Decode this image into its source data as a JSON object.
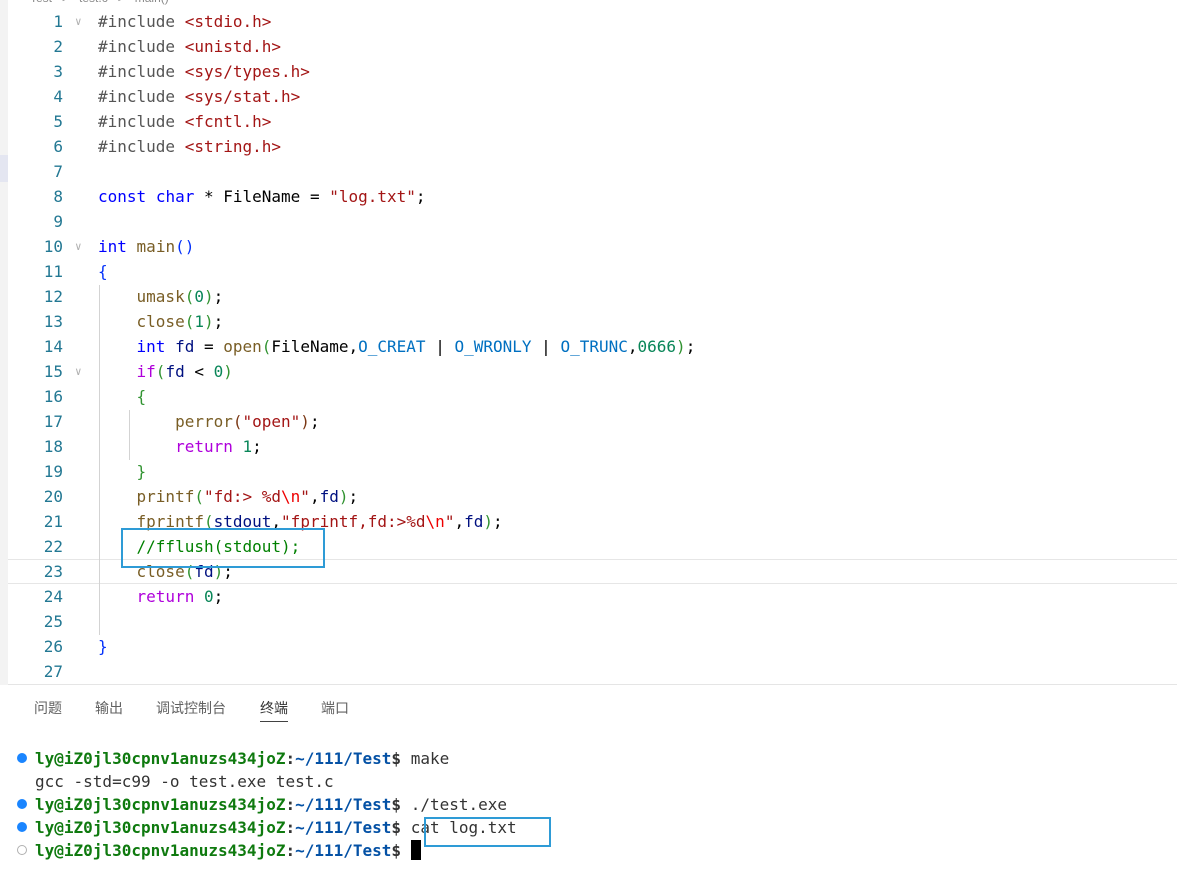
{
  "breadcrumb": [
    "Test",
    ">",
    "test.c",
    ">",
    "main()"
  ],
  "code_lines": [
    {
      "n": "1",
      "tokens": [
        [
          "pre",
          "#include "
        ],
        [
          "str",
          "<stdio.h>"
        ]
      ]
    },
    {
      "n": "2",
      "tokens": [
        [
          "pre",
          "#include "
        ],
        [
          "str",
          "<unistd.h>"
        ]
      ]
    },
    {
      "n": "3",
      "tokens": [
        [
          "pre",
          "#include "
        ],
        [
          "str",
          "<sys/types.h>"
        ]
      ]
    },
    {
      "n": "4",
      "tokens": [
        [
          "pre",
          "#include "
        ],
        [
          "str",
          "<sys/stat.h>"
        ]
      ]
    },
    {
      "n": "5",
      "tokens": [
        [
          "pre",
          "#include "
        ],
        [
          "str",
          "<fcntl.h>"
        ]
      ]
    },
    {
      "n": "6",
      "tokens": [
        [
          "pre",
          "#include "
        ],
        [
          "str",
          "<string.h>"
        ]
      ]
    },
    {
      "n": "7",
      "tokens": []
    },
    {
      "n": "8",
      "tokens": [
        [
          "kw",
          "const"
        ],
        [
          "",
          " "
        ],
        [
          "kw",
          "char"
        ],
        [
          "",
          " * "
        ],
        [
          "",
          "FileName"
        ],
        [
          "",
          " = "
        ],
        [
          "str",
          "\"log.txt\""
        ],
        [
          "",
          ";"
        ]
      ]
    },
    {
      "n": "9",
      "tokens": []
    },
    {
      "n": "10",
      "tokens": [
        [
          "kw",
          "int"
        ],
        [
          "",
          " "
        ],
        [
          "fn",
          "main"
        ],
        [
          "b1",
          "()"
        ]
      ]
    },
    {
      "n": "11",
      "tokens": [
        [
          "b1",
          "{"
        ]
      ]
    },
    {
      "n": "12",
      "tokens": [
        [
          "",
          "    "
        ],
        [
          "fn",
          "umask"
        ],
        [
          "b2",
          "("
        ],
        [
          "num",
          "0"
        ],
        [
          "b2",
          ")"
        ],
        [
          "",
          ";"
        ]
      ]
    },
    {
      "n": "13",
      "tokens": [
        [
          "",
          "    "
        ],
        [
          "fn",
          "close"
        ],
        [
          "b2",
          "("
        ],
        [
          "num",
          "1"
        ],
        [
          "b2",
          ")"
        ],
        [
          "",
          ";"
        ]
      ]
    },
    {
      "n": "14",
      "tokens": [
        [
          "",
          "    "
        ],
        [
          "kw",
          "int"
        ],
        [
          "",
          " "
        ],
        [
          "var",
          "fd"
        ],
        [
          "",
          " = "
        ],
        [
          "fn",
          "open"
        ],
        [
          "b2",
          "("
        ],
        [
          "",
          "FileName,"
        ],
        [
          "mac",
          "O_CREAT"
        ],
        [
          "",
          " | "
        ],
        [
          "mac",
          "O_WRONLY"
        ],
        [
          "",
          " | "
        ],
        [
          "mac",
          "O_TRUNC"
        ],
        [
          "",
          ","
        ],
        [
          "num",
          "0666"
        ],
        [
          "b2",
          ")"
        ],
        [
          "",
          ";"
        ]
      ]
    },
    {
      "n": "15",
      "tokens": [
        [
          "",
          "    "
        ],
        [
          "ctl",
          "if"
        ],
        [
          "b2",
          "("
        ],
        [
          "var",
          "fd"
        ],
        [
          "",
          " < "
        ],
        [
          "num",
          "0"
        ],
        [
          "b2",
          ")"
        ]
      ]
    },
    {
      "n": "16",
      "tokens": [
        [
          "",
          "    "
        ],
        [
          "b2",
          "{"
        ]
      ]
    },
    {
      "n": "17",
      "tokens": [
        [
          "",
          "        "
        ],
        [
          "fn",
          "perror"
        ],
        [
          "b3",
          "("
        ],
        [
          "str",
          "\"open\""
        ],
        [
          "b3",
          ")"
        ],
        [
          "",
          ";"
        ]
      ]
    },
    {
      "n": "18",
      "tokens": [
        [
          "",
          "        "
        ],
        [
          "ctl",
          "return"
        ],
        [
          "",
          " "
        ],
        [
          "num",
          "1"
        ],
        [
          "",
          ";"
        ]
      ]
    },
    {
      "n": "19",
      "tokens": [
        [
          "",
          "    "
        ],
        [
          "b2",
          "}"
        ]
      ]
    },
    {
      "n": "20",
      "tokens": [
        [
          "",
          "    "
        ],
        [
          "fn",
          "printf"
        ],
        [
          "b2",
          "("
        ],
        [
          "str",
          "\"fd:> %d"
        ],
        [
          "esc",
          "\\n"
        ],
        [
          "str",
          "\""
        ],
        [
          "",
          ","
        ],
        [
          "var",
          "fd"
        ],
        [
          "b2",
          ")"
        ],
        [
          "",
          ";"
        ]
      ]
    },
    {
      "n": "21",
      "tokens": [
        [
          "",
          "    "
        ],
        [
          "fn",
          "fprintf"
        ],
        [
          "b2",
          "("
        ],
        [
          "var",
          "stdout"
        ],
        [
          "",
          ","
        ],
        [
          "str",
          "\"fprintf,fd:>%d"
        ],
        [
          "esc",
          "\\n"
        ],
        [
          "str",
          "\""
        ],
        [
          "",
          ","
        ],
        [
          "var",
          "fd"
        ],
        [
          "b2",
          ")"
        ],
        [
          "",
          ";"
        ]
      ]
    },
    {
      "n": "22",
      "tokens": [
        [
          "",
          "    "
        ],
        [
          "cmt",
          "//fflush(stdout);"
        ]
      ]
    },
    {
      "n": "23",
      "tokens": [
        [
          "",
          "    "
        ],
        [
          "fn",
          "close"
        ],
        [
          "b2",
          "("
        ],
        [
          "var",
          "fd"
        ],
        [
          "b2",
          ")"
        ],
        [
          "",
          ";"
        ]
      ]
    },
    {
      "n": "24",
      "tokens": [
        [
          "",
          "    "
        ],
        [
          "ctl",
          "return"
        ],
        [
          "",
          " "
        ],
        [
          "num",
          "0"
        ],
        [
          "",
          ";"
        ]
      ]
    },
    {
      "n": "25",
      "tokens": []
    },
    {
      "n": "26",
      "tokens": [
        [
          "b1",
          "}"
        ]
      ]
    },
    {
      "n": "27",
      "tokens": []
    }
  ],
  "panel": {
    "tabs": [
      "问题",
      "输出",
      "调试控制台",
      "终端",
      "端口"
    ],
    "active_tab": "终端"
  },
  "terminal": {
    "user_host": "ly@iZ0jl30cpnv1anuzs434joZ",
    "path": "~/111/Test",
    "lines": [
      {
        "dot": "filled",
        "prompt": true,
        "cmd": "make"
      },
      {
        "dot": "none",
        "prompt": false,
        "output": "gcc -std=c99 -o test.exe test.c"
      },
      {
        "dot": "filled",
        "prompt": true,
        "cmd": "./test.exe"
      },
      {
        "dot": "filled",
        "prompt": true,
        "cmd": "cat log.txt"
      },
      {
        "dot": "hollow",
        "prompt": true,
        "cmd": ""
      }
    ]
  },
  "colors": {
    "line_number": "#237893",
    "keyword": "#0000ff",
    "string": "#a31515",
    "comment": "#008000",
    "highlight_box": "#2e9bd6",
    "terminal_user": "#0f7a0f",
    "terminal_path": "#0451a5",
    "status_dot": "#1a85ff"
  }
}
